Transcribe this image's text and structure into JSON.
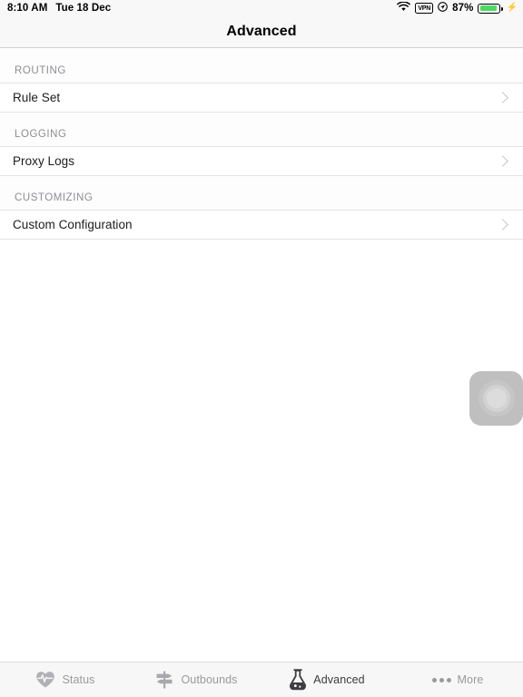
{
  "status_bar": {
    "time": "8:10 AM",
    "date": "Tue 18 Dec",
    "wifi_icon": "wifi-icon",
    "vpn_label": "VPN",
    "location_icon": "location-arrow-icon",
    "battery_percent": "87%",
    "battery_level": 87,
    "battery_color": "#4cd964",
    "charging_icon": "lightning-bolt-icon"
  },
  "navbar": {
    "title": "Advanced"
  },
  "sections": [
    {
      "header": "ROUTING",
      "rows": [
        {
          "label": "Rule Set",
          "accessory": "chevron-right-icon"
        }
      ]
    },
    {
      "header": "LOGGING",
      "rows": [
        {
          "label": "Proxy Logs",
          "accessory": "chevron-right-icon"
        }
      ]
    },
    {
      "header": "CUSTOMIZING",
      "rows": [
        {
          "label": "Custom Configuration",
          "accessory": "chevron-right-icon"
        }
      ]
    }
  ],
  "assistive_touch": {
    "name": "assistive-touch-button",
    "color": "#bfbfbf"
  },
  "tabbar": {
    "tabs": [
      {
        "label": "Status",
        "icon": "heart-pulse-icon",
        "active": false
      },
      {
        "label": "Outbounds",
        "icon": "signpost-icon",
        "active": false
      },
      {
        "label": "Advanced",
        "icon": "flask-icon",
        "active": true
      },
      {
        "label": "More",
        "icon": "ellipsis-icon",
        "active": false
      }
    ],
    "active_color": "#3c3c41",
    "inactive_color": "#9a9a9f"
  }
}
